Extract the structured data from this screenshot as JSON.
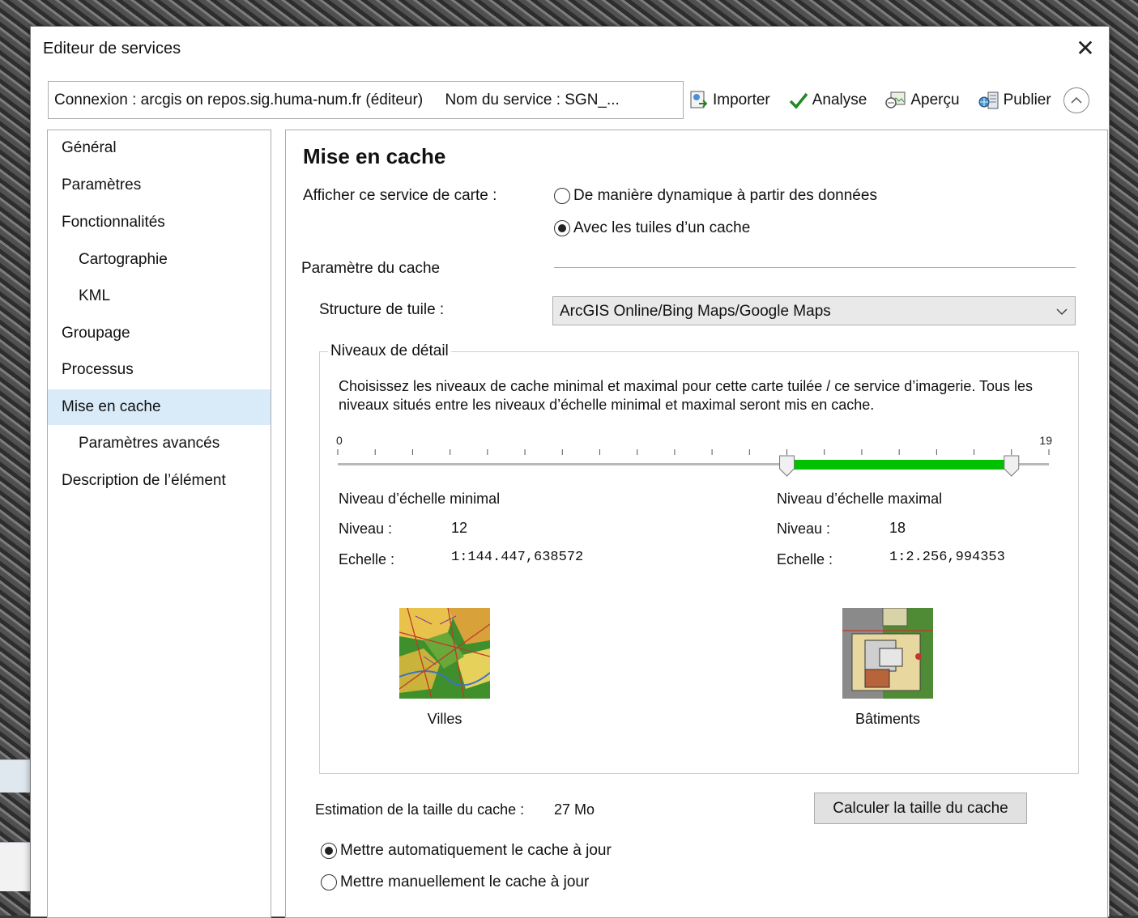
{
  "window": {
    "title": "Editeur de services",
    "close_glyph": "✕"
  },
  "connection": {
    "label": "Connexion : arcgis on repos.sig.huma-num.fr (éditeur)",
    "service": "Nom du service : SGN_..."
  },
  "toolbar": {
    "import": "Importer",
    "analyze": "Analyse",
    "preview": "Aperçu",
    "publish": "Publier"
  },
  "nav": {
    "items": [
      {
        "label": "Général"
      },
      {
        "label": "Paramètres"
      },
      {
        "label": "Fonctionnalités"
      },
      {
        "label": "Cartographie"
      },
      {
        "label": "KML"
      },
      {
        "label": "Groupage"
      },
      {
        "label": "Processus"
      },
      {
        "label": "Mise en cache"
      },
      {
        "label": "Paramètres avancés"
      },
      {
        "label": "Description de l’élément"
      }
    ],
    "selected": "Mise en cache"
  },
  "panel": {
    "title": "Mise en cache",
    "display_label": "Afficher ce service de carte :",
    "display_options": [
      "De manière dynamique à partir des données",
      "Avec les tuiles d’un cache"
    ],
    "display_selected": "Avec les tuiles d’un cache",
    "cache_params_label": "Paramètre du cache",
    "tile_structure_label": "Structure de tuile :",
    "tile_structure_value": "ArcGIS Online/Bing Maps/Google Maps",
    "lod_group_label": "Niveaux de détail",
    "lod_description": "Choisissez les niveaux de cache minimal et maximal pour cette carte tuilée / ce service d’imagerie. Tous les niveaux situés entre les niveaux d’échelle minimal et maximal seront mis en cache.",
    "slider": {
      "min_label": "0",
      "max_label": "19",
      "min": 0,
      "max": 19,
      "low": 12,
      "high": 18,
      "fill_color": "#00c000"
    },
    "min_scale": {
      "heading": "Niveau d’échelle minimal",
      "level_label": "Niveau :",
      "level_value": "12",
      "scale_label": "Echelle :",
      "scale_value": "1:144.447,638572",
      "thumb_caption": "Villes"
    },
    "max_scale": {
      "heading": "Niveau d’échelle maximal",
      "level_label": "Niveau :",
      "level_value": "18",
      "scale_label": "Echelle :",
      "scale_value": "1:2.256,994353",
      "thumb_caption": "Bâtiments"
    },
    "estimate_label": "Estimation de la taille du cache :",
    "estimate_value": "27 Mo",
    "calc_button": "Calculer la taille du cache",
    "update_options": [
      "Mettre automatiquement le cache à jour",
      "Mettre manuellement le cache à jour"
    ],
    "update_selected": "Mettre automatiquement le cache à jour"
  }
}
